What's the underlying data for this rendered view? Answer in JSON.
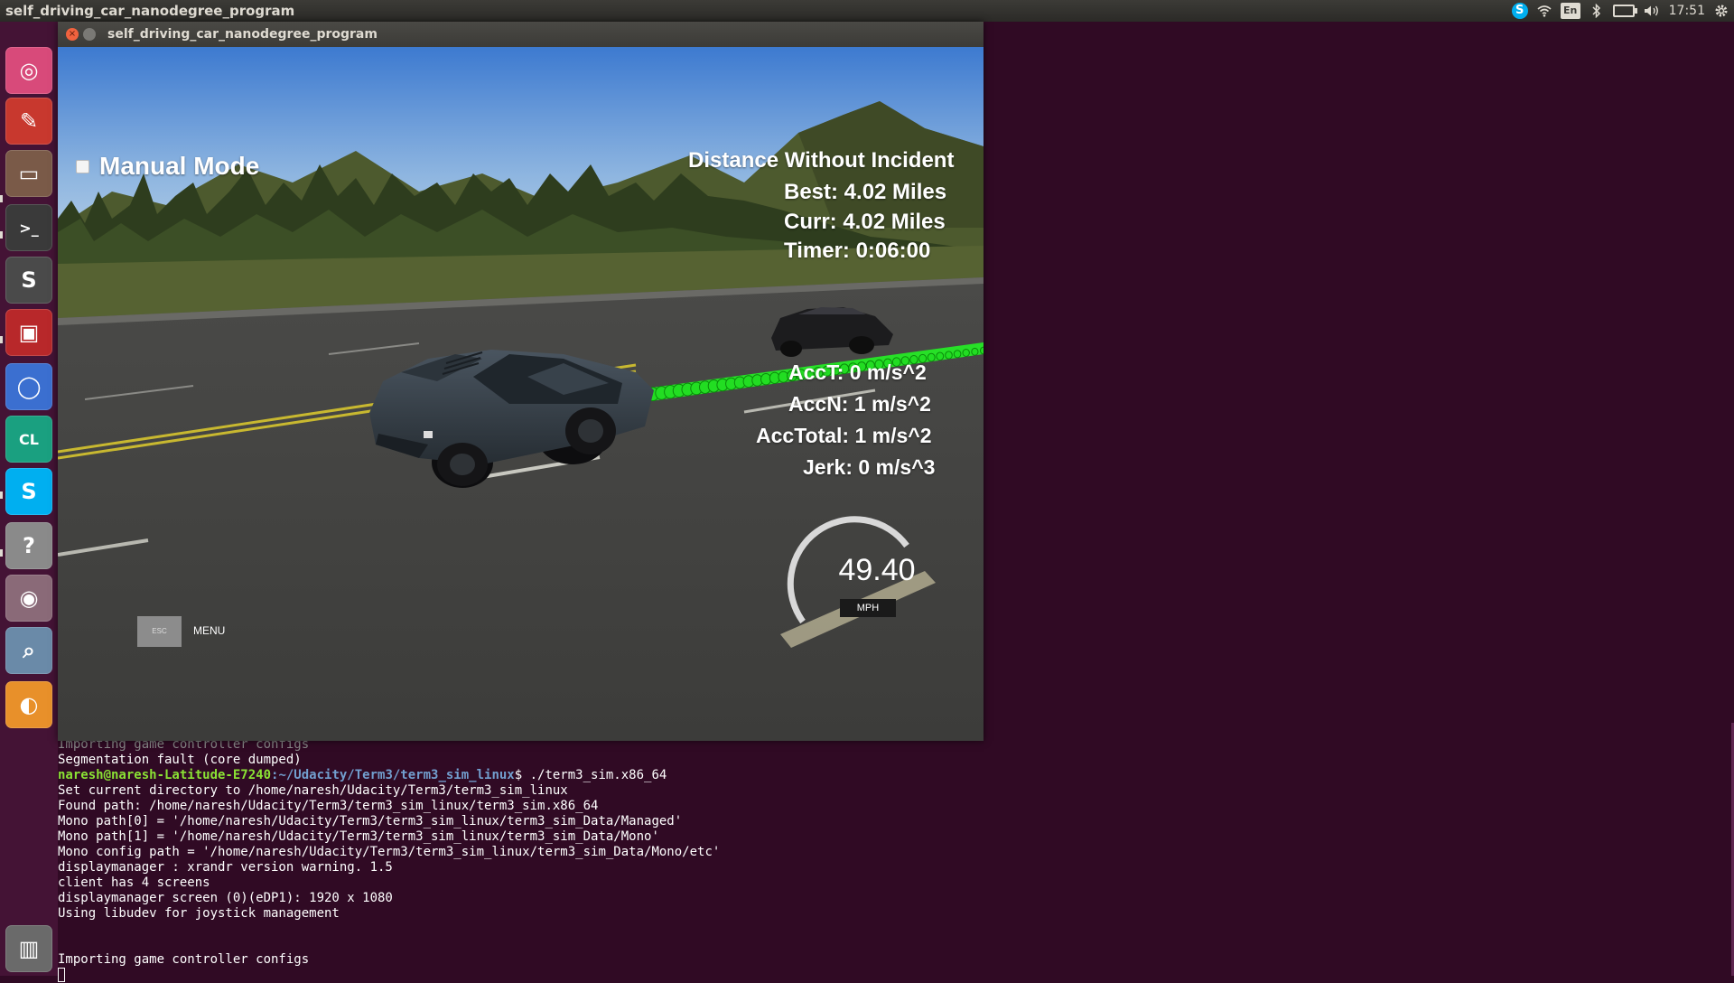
{
  "top_panel": {
    "active_app_title": "self_driving_car_nanodegree_program",
    "keyboard_layout": "En",
    "clock": "17:51",
    "icons": [
      "skype-icon",
      "wifi-icon",
      "keyboard-layout-icon",
      "bluetooth-icon",
      "battery-icon",
      "volume-icon",
      "clock",
      "gear-icon"
    ]
  },
  "launcher": {
    "items": [
      {
        "name": "ubuntu-dash-icon",
        "color": "#d84a7a"
      },
      {
        "name": "system-settings-icon",
        "color": "#c8382e"
      },
      {
        "name": "files-icon",
        "color": "#7a5a48"
      },
      {
        "name": "terminal-icon",
        "color": "#3a3a3a"
      },
      {
        "name": "sublime-text-icon",
        "color": "#4a4a4a"
      },
      {
        "name": "red-app-icon",
        "color": "#b8282a"
      },
      {
        "name": "chromium-icon",
        "color": "#3b6fd0"
      },
      {
        "name": "clion-icon",
        "color": "#1aa080"
      },
      {
        "name": "skype-icon",
        "color": "#00aff0"
      },
      {
        "name": "help-icon",
        "color": "#8a8a8a"
      },
      {
        "name": "screenshot-icon",
        "color": "#8a6a78"
      },
      {
        "name": "document-viewer-icon",
        "color": "#6a8aa8"
      },
      {
        "name": "blender-icon",
        "color": "#e8902a"
      },
      {
        "name": "trash-icon",
        "color": "#6a6a6a"
      }
    ]
  },
  "window": {
    "title": "self_driving_car_nanodegree_program"
  },
  "hud": {
    "manual_mode_label": "Manual Mode",
    "manual_mode_checked": false,
    "distance_title": "Distance Without Incident",
    "best": "Best: 4.02 Miles",
    "curr": "Curr: 4.02 Miles",
    "timer": "Timer: 0:06:00",
    "acc_t": "AccT: 0 m/s^2",
    "acc_n": "AccN: 1 m/s^2",
    "acc_total": "AccTotal: 1 m/s^2",
    "jerk": "Jerk: 0 m/s^3",
    "speed": "49.40",
    "speed_unit": "MPH",
    "esc_key": "ESC",
    "menu_label": "MENU"
  },
  "terminal": {
    "partial_line": "Importing game controller configs",
    "segfault_line": "Segmentation fault (core dumped)",
    "prompt_user": "naresh@naresh-Latitude-E7240",
    "prompt_path": ":~/Udacity/Term3/term3_sim_linux",
    "prompt_command": "$ ./term3_sim.x86_64",
    "output_lines": [
      "Set current directory to /home/naresh/Udacity/Term3/term3_sim_linux",
      "Found path: /home/naresh/Udacity/Term3/term3_sim_linux/term3_sim.x86_64",
      "Mono path[0] = '/home/naresh/Udacity/Term3/term3_sim_linux/term3_sim_Data/Managed'",
      "Mono path[1] = '/home/naresh/Udacity/Term3/term3_sim_linux/term3_sim_Data/Mono'",
      "Mono config path = '/home/naresh/Udacity/Term3/term3_sim_linux/term3_sim_Data/Mono/etc'",
      "displaymanager : xrandr version warning. 1.5",
      "client has 4 screens",
      "displaymanager screen (0)(eDP1): 1920 x 1080",
      "Using libudev for joystick management"
    ],
    "last_line": "Importing game controller configs"
  }
}
